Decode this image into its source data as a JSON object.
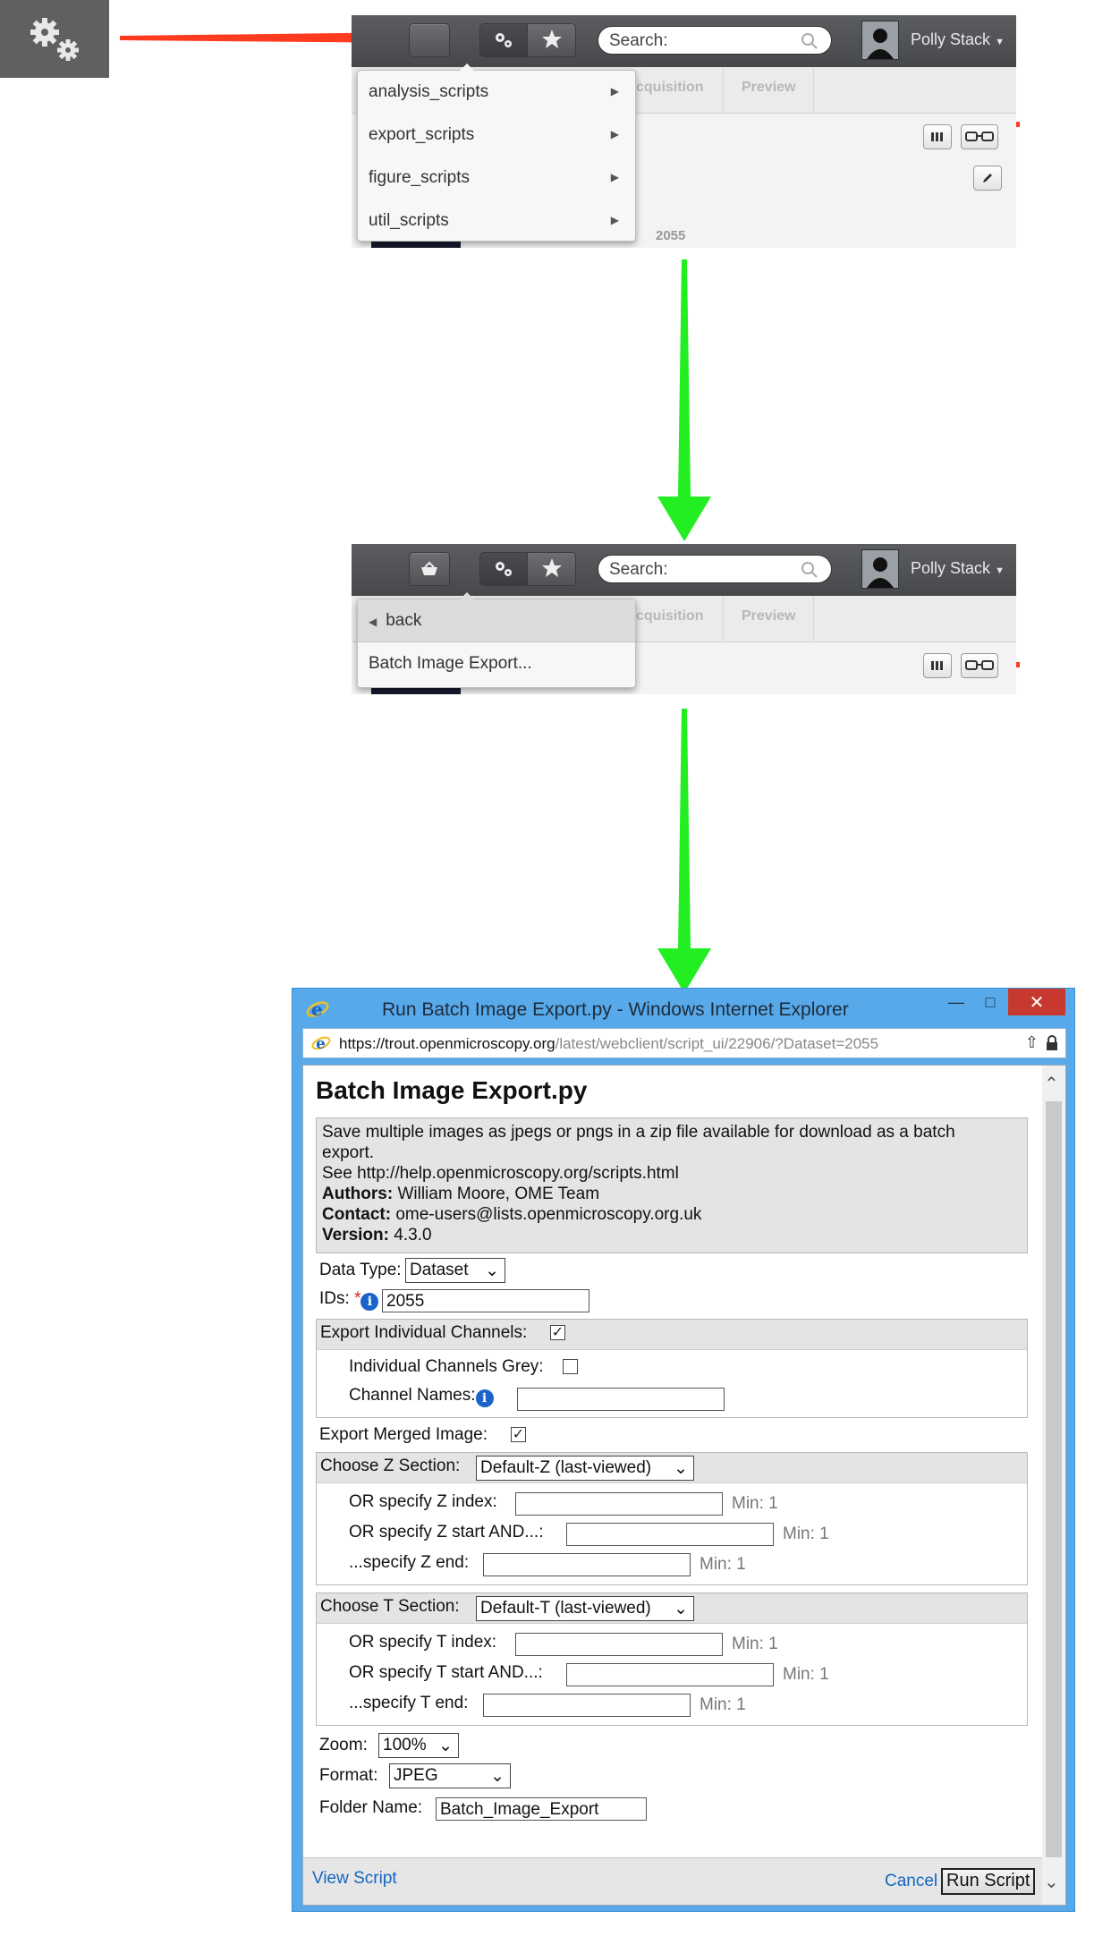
{
  "colors": {
    "red_arrow": "#ff3b1f",
    "green_arrow": "#22ee22",
    "toolbar": "#4d4f52",
    "ie_frame": "#57a9ea",
    "link": "#1565c0"
  },
  "icons": [
    "gears-icon",
    "stars-icon",
    "basket-icon",
    "magnifier-icon",
    "user-avatar-icon",
    "ie-logo-icon",
    "lock-icon",
    "share-icon"
  ],
  "toolbar": {
    "search_placeholder": "Search:",
    "username": "Polly Stack",
    "faded_tabs": [
      "cquisition",
      "Preview"
    ],
    "faded_number": "2055"
  },
  "menu1": {
    "items": [
      "analysis_scripts",
      "export_scripts",
      "figure_scripts",
      "util_scripts"
    ]
  },
  "menu2": {
    "back_label": "back",
    "items": [
      "Batch Image Export..."
    ]
  },
  "browser": {
    "title": "Run Batch Image Export.py - Windows Internet Explorer",
    "url_prefix": "https://trout.",
    "url_host": "openmicroscopy.org",
    "url_path": "/latest/webclient/script_ui/22906/?Dataset=2055"
  },
  "script": {
    "title": "Batch Image Export.py",
    "description_1": "Save multiple images as jpegs or pngs in a zip file available for download as a batch",
    "description_2": "export.",
    "see_line": "See http://help.openmicroscopy.org/scripts.html",
    "authors_label": "Authors:",
    "authors": "William Moore, OME Team",
    "contact_label": "Contact:",
    "contact": "ome-users@lists.openmicroscopy.org.uk",
    "version_label": "Version:",
    "version": "4.3.0"
  },
  "form": {
    "data_type_label": "Data Type:",
    "data_type_value": "Dataset",
    "ids_label": "IDs:",
    "ids_value": "2055",
    "export_channels_label": "Export Individual Channels:",
    "export_channels_checked": true,
    "channels_grey_label": "Individual Channels Grey:",
    "channels_grey_checked": false,
    "channel_names_label": "Channel Names:",
    "channel_names_value": "",
    "export_merged_label": "Export Merged Image:",
    "export_merged_checked": true,
    "z_section_label": "Choose Z Section:",
    "z_section_value": "Default-Z (last-viewed)",
    "z_index_label": "OR specify Z index:",
    "z_start_label": "OR specify Z start AND...:",
    "z_end_label": "...specify Z end:",
    "t_section_label": "Choose T Section:",
    "t_section_value": "Default-T (last-viewed)",
    "t_index_label": "OR specify T index:",
    "t_start_label": "OR specify T start AND...:",
    "t_end_label": "...specify T end:",
    "min_label": "Min: 1",
    "zoom_label": "Zoom:",
    "zoom_value": "100%",
    "format_label": "Format:",
    "format_value": "JPEG",
    "folder_label": "Folder Name:",
    "folder_value": "Batch_Image_Export"
  },
  "footer": {
    "view_script": "View Script",
    "cancel": "Cancel",
    "run_script": "Run Script"
  }
}
